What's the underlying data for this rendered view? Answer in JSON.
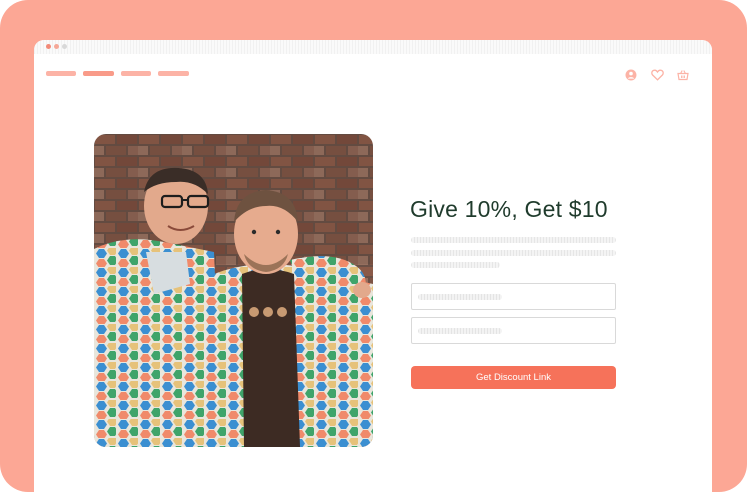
{
  "colors": {
    "frame": "#fca795",
    "accent": "#f6725a",
    "heading": "#1f3b2c"
  },
  "nav": {
    "links": [
      "",
      "",
      "",
      ""
    ],
    "icons": [
      "account-icon",
      "heart-icon",
      "basket-icon"
    ]
  },
  "promo": {
    "headline": "Give 10%, Get $10",
    "image_alt": "Two smiling men in matching hexagon-print shirts in front of a brick wall",
    "fields": [
      "",
      ""
    ],
    "button_label": "Get Discount Link"
  }
}
